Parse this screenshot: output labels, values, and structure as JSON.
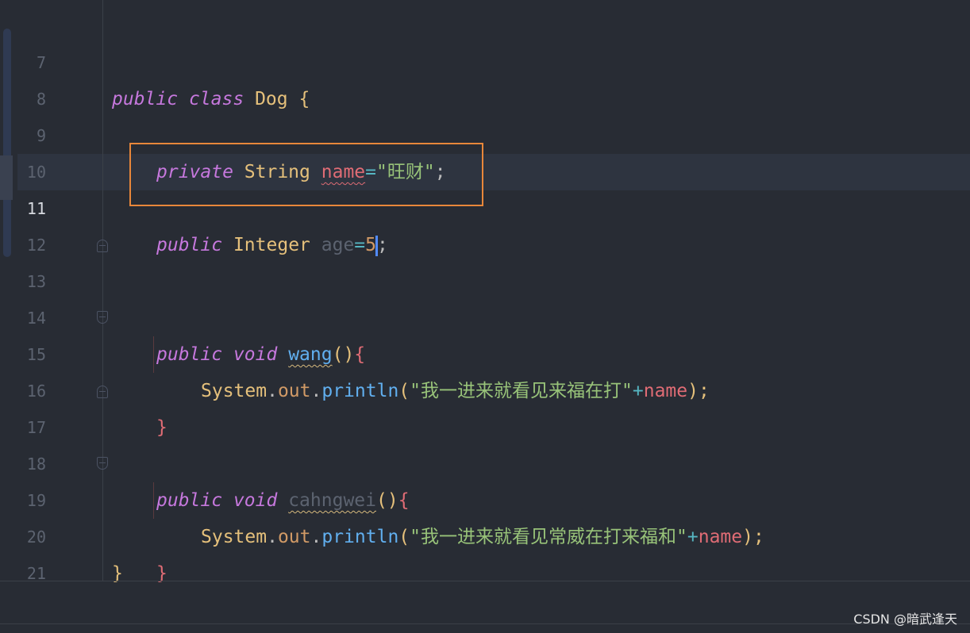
{
  "editor": {
    "line_numbers": [
      "7",
      "8",
      "9",
      "10",
      "11",
      "12",
      "13",
      "14",
      "15",
      "16",
      "17",
      "18",
      "19",
      "20",
      "21"
    ],
    "active_line": "11",
    "code": {
      "l7": {
        "kw1": "public",
        "kw2": "class",
        "name": "Dog",
        "brace": "{"
      },
      "l9": {
        "kw": "private",
        "type": "String",
        "field": "name",
        "eq": "=",
        "value": "\"旺财\"",
        "semi": ";"
      },
      "l11": {
        "kw": "public",
        "type": "Integer",
        "field": "age",
        "eq": "=",
        "value": "5",
        "semi": ";"
      },
      "l13": {
        "kw1": "public",
        "kw2": "void",
        "method": "wang",
        "parens": "()",
        "brace": "{"
      },
      "l14": {
        "cls": "System",
        "dot1": ".",
        "field": "out",
        "dot2": ".",
        "method": "println",
        "open": "(",
        "str": "\"我一进来就看见来福在打\"",
        "plus": "+",
        "arg": "name",
        "close": ");"
      },
      "l15": {
        "brace": "}"
      },
      "l17": {
        "kw1": "public",
        "kw2": "void",
        "method": "cahngwei",
        "parens": "()",
        "brace": "{"
      },
      "l18": {
        "cls": "System",
        "dot1": ".",
        "field": "out",
        "dot2": ".",
        "method": "println",
        "open": "(",
        "str": "\"我一进来就看见常威在打来福和\"",
        "plus": "+",
        "arg": "name",
        "close": ");"
      },
      "l19": {
        "brace": "}"
      },
      "l20": {
        "brace": "}"
      }
    }
  },
  "watermark": "CSDN @暗武逢天",
  "colors": {
    "background": "#282c34",
    "keyword": "#c678dd",
    "type": "#e5c07b",
    "string": "#98c379",
    "field": "#e06c75",
    "method": "#61afef",
    "highlight_box": "#e8873a"
  }
}
